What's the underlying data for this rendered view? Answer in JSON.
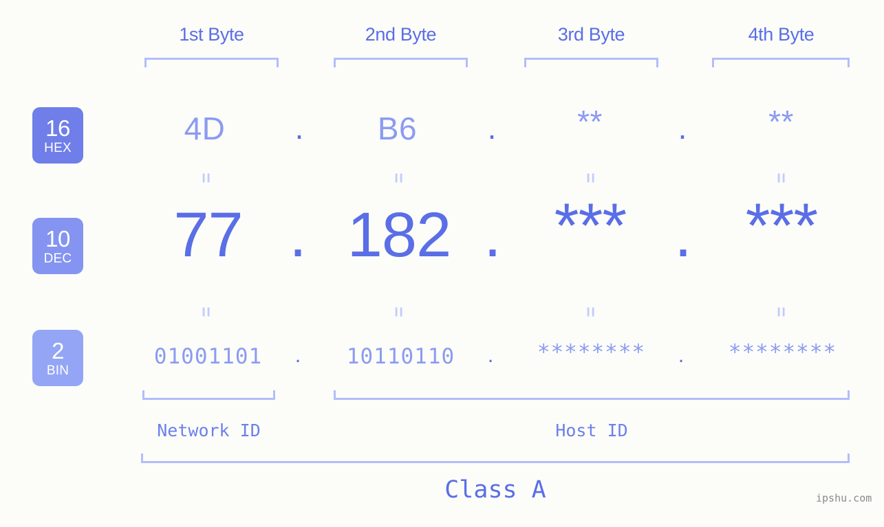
{
  "background_color": "#fcfdf9",
  "accent_color": "#5a6ee6",
  "columns": {
    "headers": [
      {
        "label": "1st Byte"
      },
      {
        "label": "2nd Byte"
      },
      {
        "label": "3rd Byte"
      },
      {
        "label": "4th Byte"
      }
    ]
  },
  "rows": {
    "hex": {
      "badge_number": "16",
      "badge_label": "HEX",
      "badge_color": "#6f7ee8",
      "values": [
        "4D",
        "B6",
        "**",
        "**"
      ],
      "separator": "."
    },
    "dec": {
      "badge_number": "10",
      "badge_label": "DEC",
      "badge_color": "#8494f0",
      "values": [
        "77",
        "182",
        "***",
        "***"
      ],
      "separator": "."
    },
    "bin": {
      "badge_number": "2",
      "badge_label": "BIN",
      "badge_color": "#93a5f4",
      "values": [
        "01001101",
        "10110110",
        "********",
        "********"
      ],
      "separator": "."
    }
  },
  "equals_symbol": "=",
  "segments": {
    "network_id": "Network ID",
    "host_id": "Host ID"
  },
  "class_label": "Class A",
  "watermark": "ipshu.com"
}
